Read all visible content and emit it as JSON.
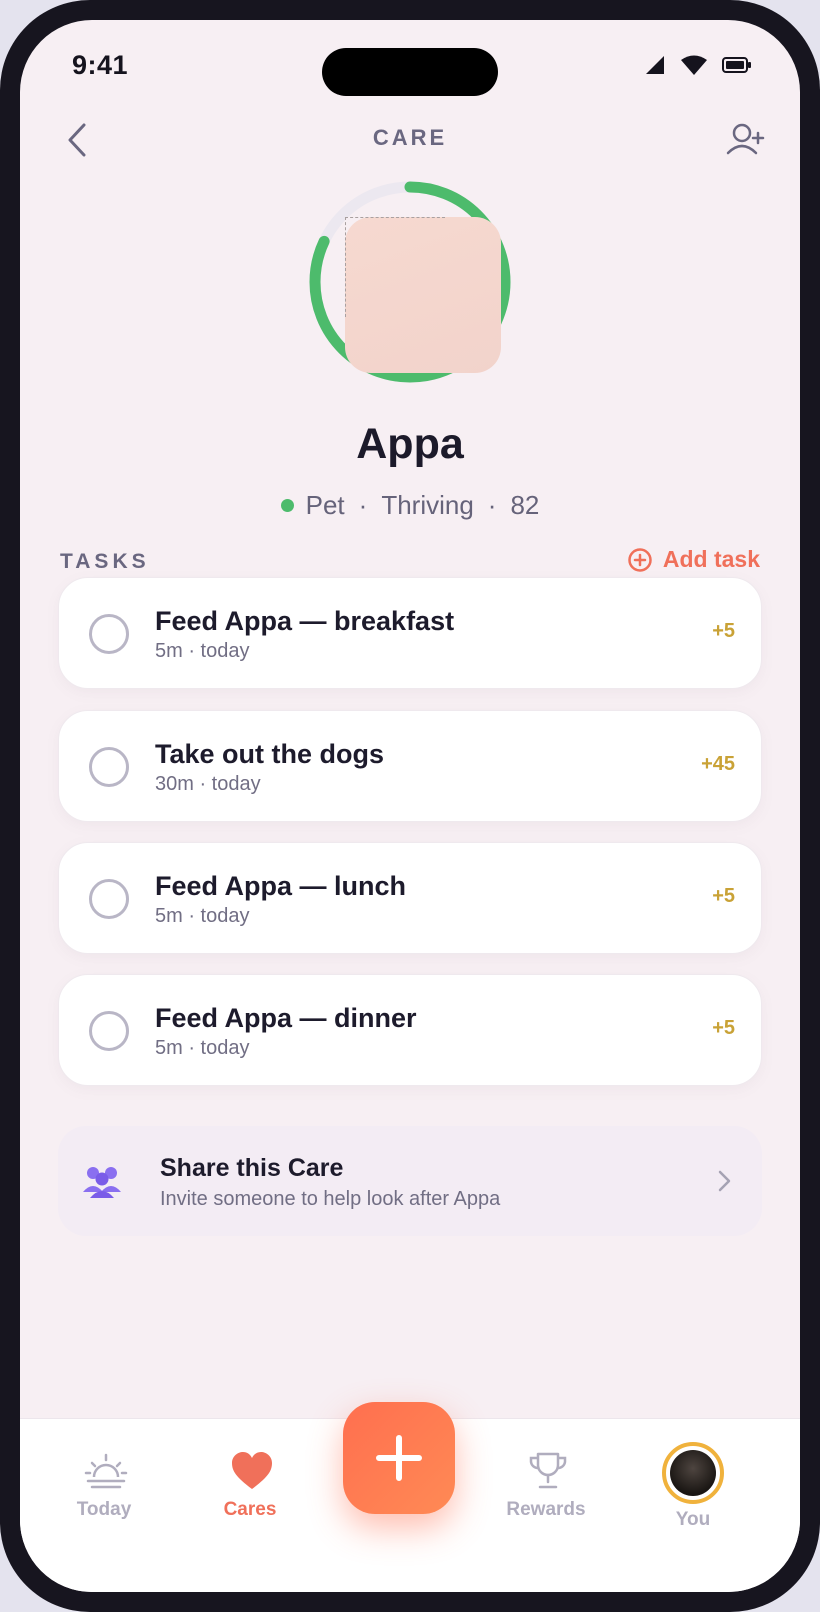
{
  "status_bar": {
    "time": "9:41"
  },
  "header": {
    "title": "CARE"
  },
  "care": {
    "name": "Appa",
    "category": "Pet",
    "state": "Thriving",
    "score": "82",
    "score_progress": 0.82,
    "state_color": "#4dbb6c"
  },
  "tasks_section": {
    "label": "TASKS",
    "add_label": "Add task"
  },
  "tasks": [
    {
      "title": "Feed Appa — breakfast",
      "sub": "5m · today",
      "points": "+5"
    },
    {
      "title": "Take out the dogs",
      "sub": "30m · today",
      "points": "+45"
    },
    {
      "title": "Feed Appa — lunch",
      "sub": "5m · today",
      "points": "+5"
    },
    {
      "title": "Feed Appa — dinner",
      "sub": "5m · today",
      "points": "+5"
    }
  ],
  "share": {
    "title": "Share this Care",
    "subtitle": "Invite someone to help look after Appa"
  },
  "tabbar": {
    "today": "Today",
    "cares": "Cares",
    "rewards": "Rewards",
    "you": "You"
  },
  "colors": {
    "accent": "#f0705a",
    "points": "#c9a236",
    "progress": "#4dbb6c"
  }
}
